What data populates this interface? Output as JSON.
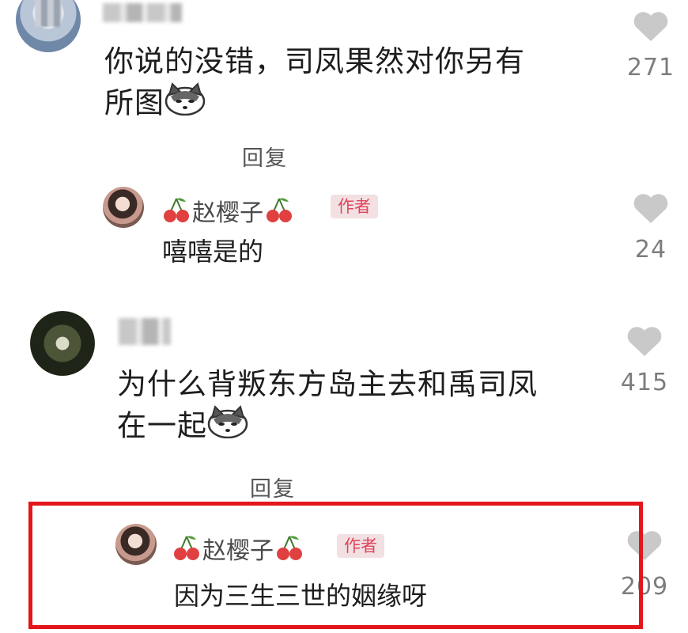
{
  "comments": [
    {
      "text_lines": [
        "你说的没错，司凤果然对你另有",
        "所图"
      ],
      "emoji": "husky-emoji",
      "likes": "271",
      "reply_label": "回复",
      "author_reply": {
        "name": "赵樱子",
        "badge": "作者",
        "text": "嘻嘻是的",
        "likes": "24"
      }
    },
    {
      "text_lines": [
        "为什么背叛东方岛主去和禹司凤",
        "在一起"
      ],
      "emoji": "husky-emoji",
      "likes": "415",
      "reply_label": "回复",
      "author_reply": {
        "name": "赵樱子",
        "badge": "作者",
        "text": "因为三生三世的姻缘呀",
        "likes": "209"
      }
    }
  ],
  "colors": {
    "highlight_border": "#e3161b",
    "badge_text": "#e0455c",
    "badge_bg": "#f2e0e3",
    "heart": "#c9c9c9"
  }
}
